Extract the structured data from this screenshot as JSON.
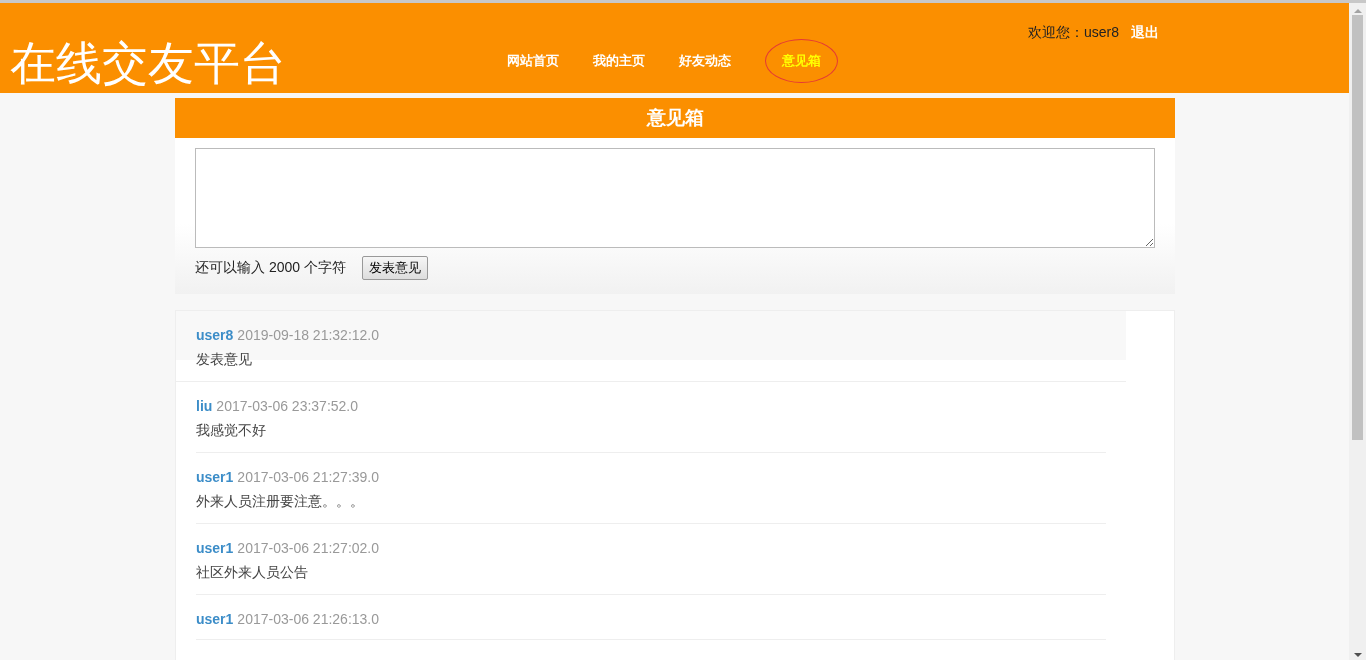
{
  "header": {
    "site_title": "在线交友平台",
    "nav": [
      {
        "label": "网站首页",
        "selected": false
      },
      {
        "label": "我的主页",
        "selected": false
      },
      {
        "label": "好友动态",
        "selected": false
      },
      {
        "label": "意见箱",
        "selected": true
      }
    ],
    "welcome": "欢迎您：user8",
    "logout": "退出"
  },
  "panel": {
    "title": "意见箱",
    "char_hint": "还可以输入 2000 个字符",
    "submit": "发表意见"
  },
  "posts": [
    {
      "user": "user8",
      "time": "2019-09-18 21:32:12.0",
      "text": "发表意见"
    },
    {
      "user": "liu",
      "time": "2017-03-06 23:37:52.0",
      "text": "我感觉不好"
    },
    {
      "user": "user1",
      "time": "2017-03-06 21:27:39.0",
      "text": "外来人员注册要注意。。。"
    },
    {
      "user": "user1",
      "time": "2017-03-06 21:27:02.0",
      "text": "社区外来人员公告"
    },
    {
      "user": "user1",
      "time": "2017-03-06 21:26:13.0"
    }
  ]
}
